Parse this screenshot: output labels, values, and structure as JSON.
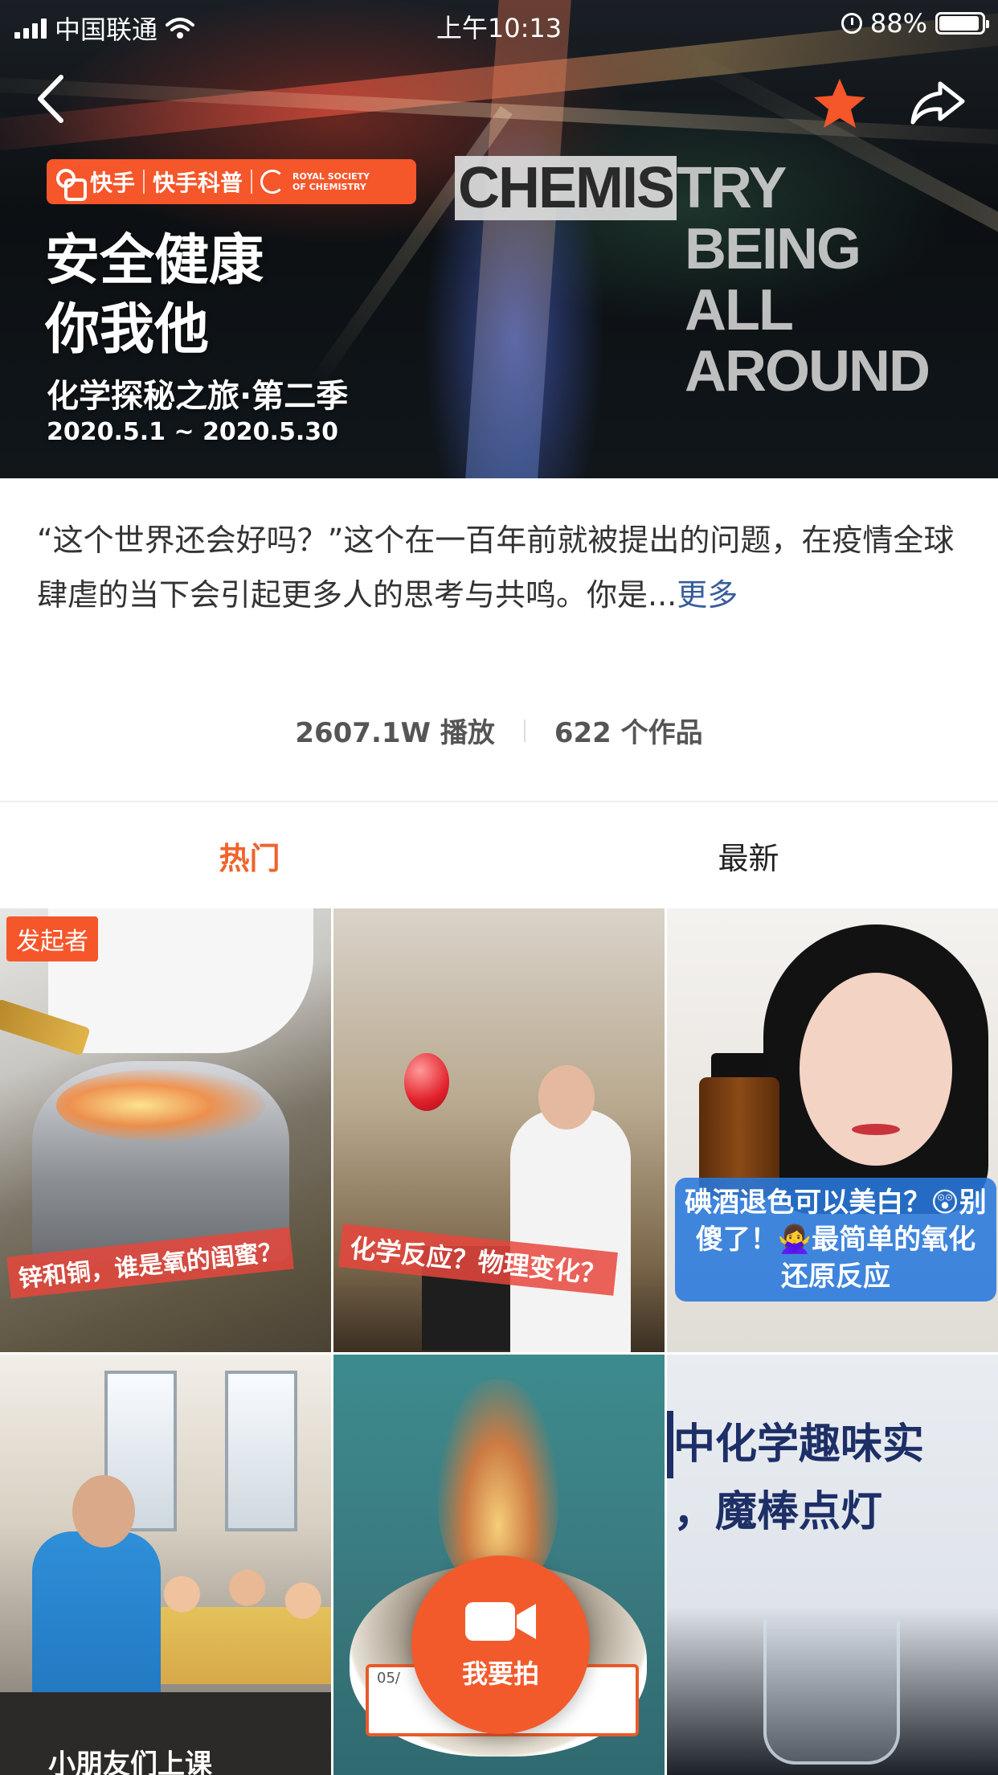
{
  "status_bar": {
    "carrier": "中国联通",
    "time": "上午10:13",
    "battery": "88%",
    "battery_level": 0.88
  },
  "header": {
    "back_icon": "chevron-left-icon",
    "favorite_icon": "star-icon",
    "favorite_color": "#f5562a",
    "share_icon": "share-arrow-icon"
  },
  "banner": {
    "brand_kuaishou": "快手",
    "brand_science": "快手科普",
    "brand_rsc_line1": "ROYAL SOCIETY",
    "brand_rsc_line2": "OF CHEMISTRY",
    "title_line1": "安全健康",
    "title_line2": "你我他",
    "subtitle": "化学探秘之旅·第二季",
    "date_range": "2020.5.1 ~ 2020.5.30",
    "en_highlight": "CHEMIS",
    "en_line1_rest": "TRY",
    "en_line2": "BEING",
    "en_line3": "ALL",
    "en_line4": "AROUND"
  },
  "description": {
    "text": "“这个世界还会好吗？”这个在一百年前就被提出的问题，在疫情全球肆虐的当下会引起更多人的思考与共鸣。你是...",
    "more_link": "更多"
  },
  "stats": {
    "plays": "2607.1W 播放",
    "works": "622 个作品"
  },
  "tabs": [
    {
      "label": "热门",
      "active": true
    },
    {
      "label": "最新",
      "active": false
    }
  ],
  "accent_color": "#f0632e",
  "videos": [
    {
      "badge": "发起者",
      "caption": "锌和铜，谁是氧的闺蜜？"
    },
    {
      "caption": "化学反应？物理变化？"
    },
    {
      "caption": "碘酒退色可以美白？😲别傻了！🙅‍♀️最简单的氧化还原反应"
    },
    {
      "caption": "小朋友们上课"
    },
    {
      "note_date": "05/"
    },
    {
      "caption_line1": "中化学趣味实",
      "caption_line2": "，魔棒点灯"
    }
  ],
  "record_button": {
    "icon": "video-camera-icon",
    "label": "我要拍"
  }
}
